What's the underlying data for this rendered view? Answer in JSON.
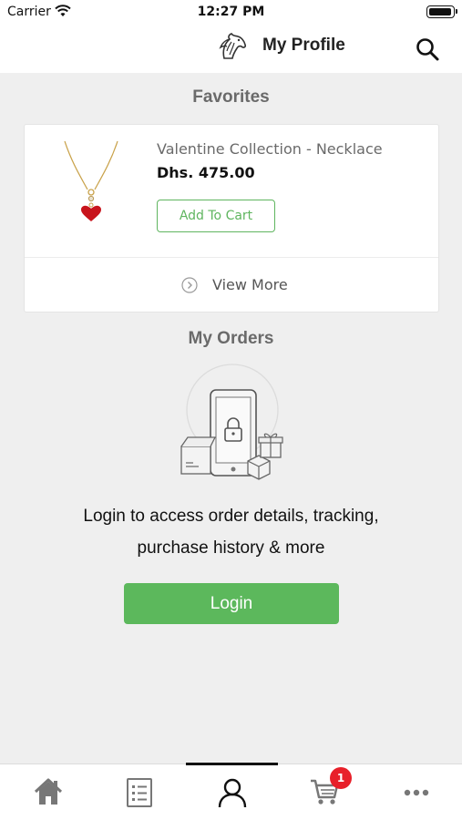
{
  "status_bar": {
    "carrier": "Carrier",
    "time": "12:27 PM"
  },
  "header": {
    "title": "My Profile",
    "logo_icon": "horse-logo-icon",
    "search_icon": "search-icon"
  },
  "favorites": {
    "title": "Favorites",
    "item": {
      "name": "Valentine Collection - Necklace",
      "price": "Dhs. 475.00",
      "add_to_cart": "Add To Cart",
      "image": "heart-necklace"
    },
    "view_more": "View More"
  },
  "orders": {
    "title": "My Orders",
    "message_line1": "Login to access order details, tracking,",
    "message_line2": "purchase history & more",
    "login_label": "Login"
  },
  "tab_bar": {
    "tabs": [
      {
        "name": "home",
        "icon": "home-icon"
      },
      {
        "name": "catalog",
        "icon": "list-icon"
      },
      {
        "name": "profile",
        "icon": "user-icon",
        "active": true
      },
      {
        "name": "cart",
        "icon": "cart-icon",
        "badge": "1"
      },
      {
        "name": "more",
        "icon": "more-dots-icon"
      }
    ]
  },
  "colors": {
    "accent_green": "#5cb85c",
    "badge_red": "#e8202a",
    "background": "#efefef"
  }
}
